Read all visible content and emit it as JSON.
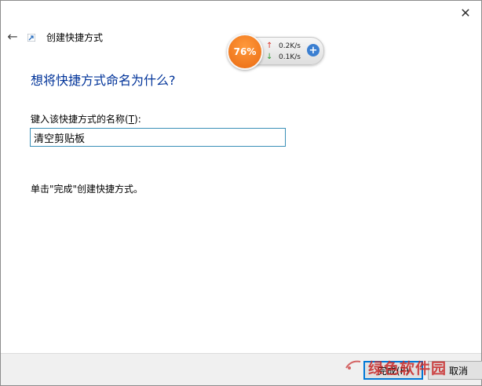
{
  "window": {
    "title": "创建快捷方式",
    "close_glyph": "✕",
    "back_glyph": "←"
  },
  "main": {
    "heading": "想将快捷方式命名为什么?",
    "field_label_prefix": "键入该快捷方式的名称(",
    "field_label_accel": "T",
    "field_label_suffix": "):",
    "name_value": "清空剪贴板",
    "instruction": "单击\"完成\"创建快捷方式。"
  },
  "footer": {
    "finish_label": "完成(F)",
    "cancel_label": "取消"
  },
  "net_widget": {
    "percent": "76%",
    "upload": "0.2K/s",
    "download": "0.1K/s",
    "up_glyph": "↑",
    "down_glyph": "↓",
    "plus_glyph": "+"
  },
  "watermark": {
    "text": "绿色软件园"
  },
  "colors": {
    "heading": "#003399",
    "accent": "#0078d7",
    "widget_orange": "#ea6a12"
  }
}
